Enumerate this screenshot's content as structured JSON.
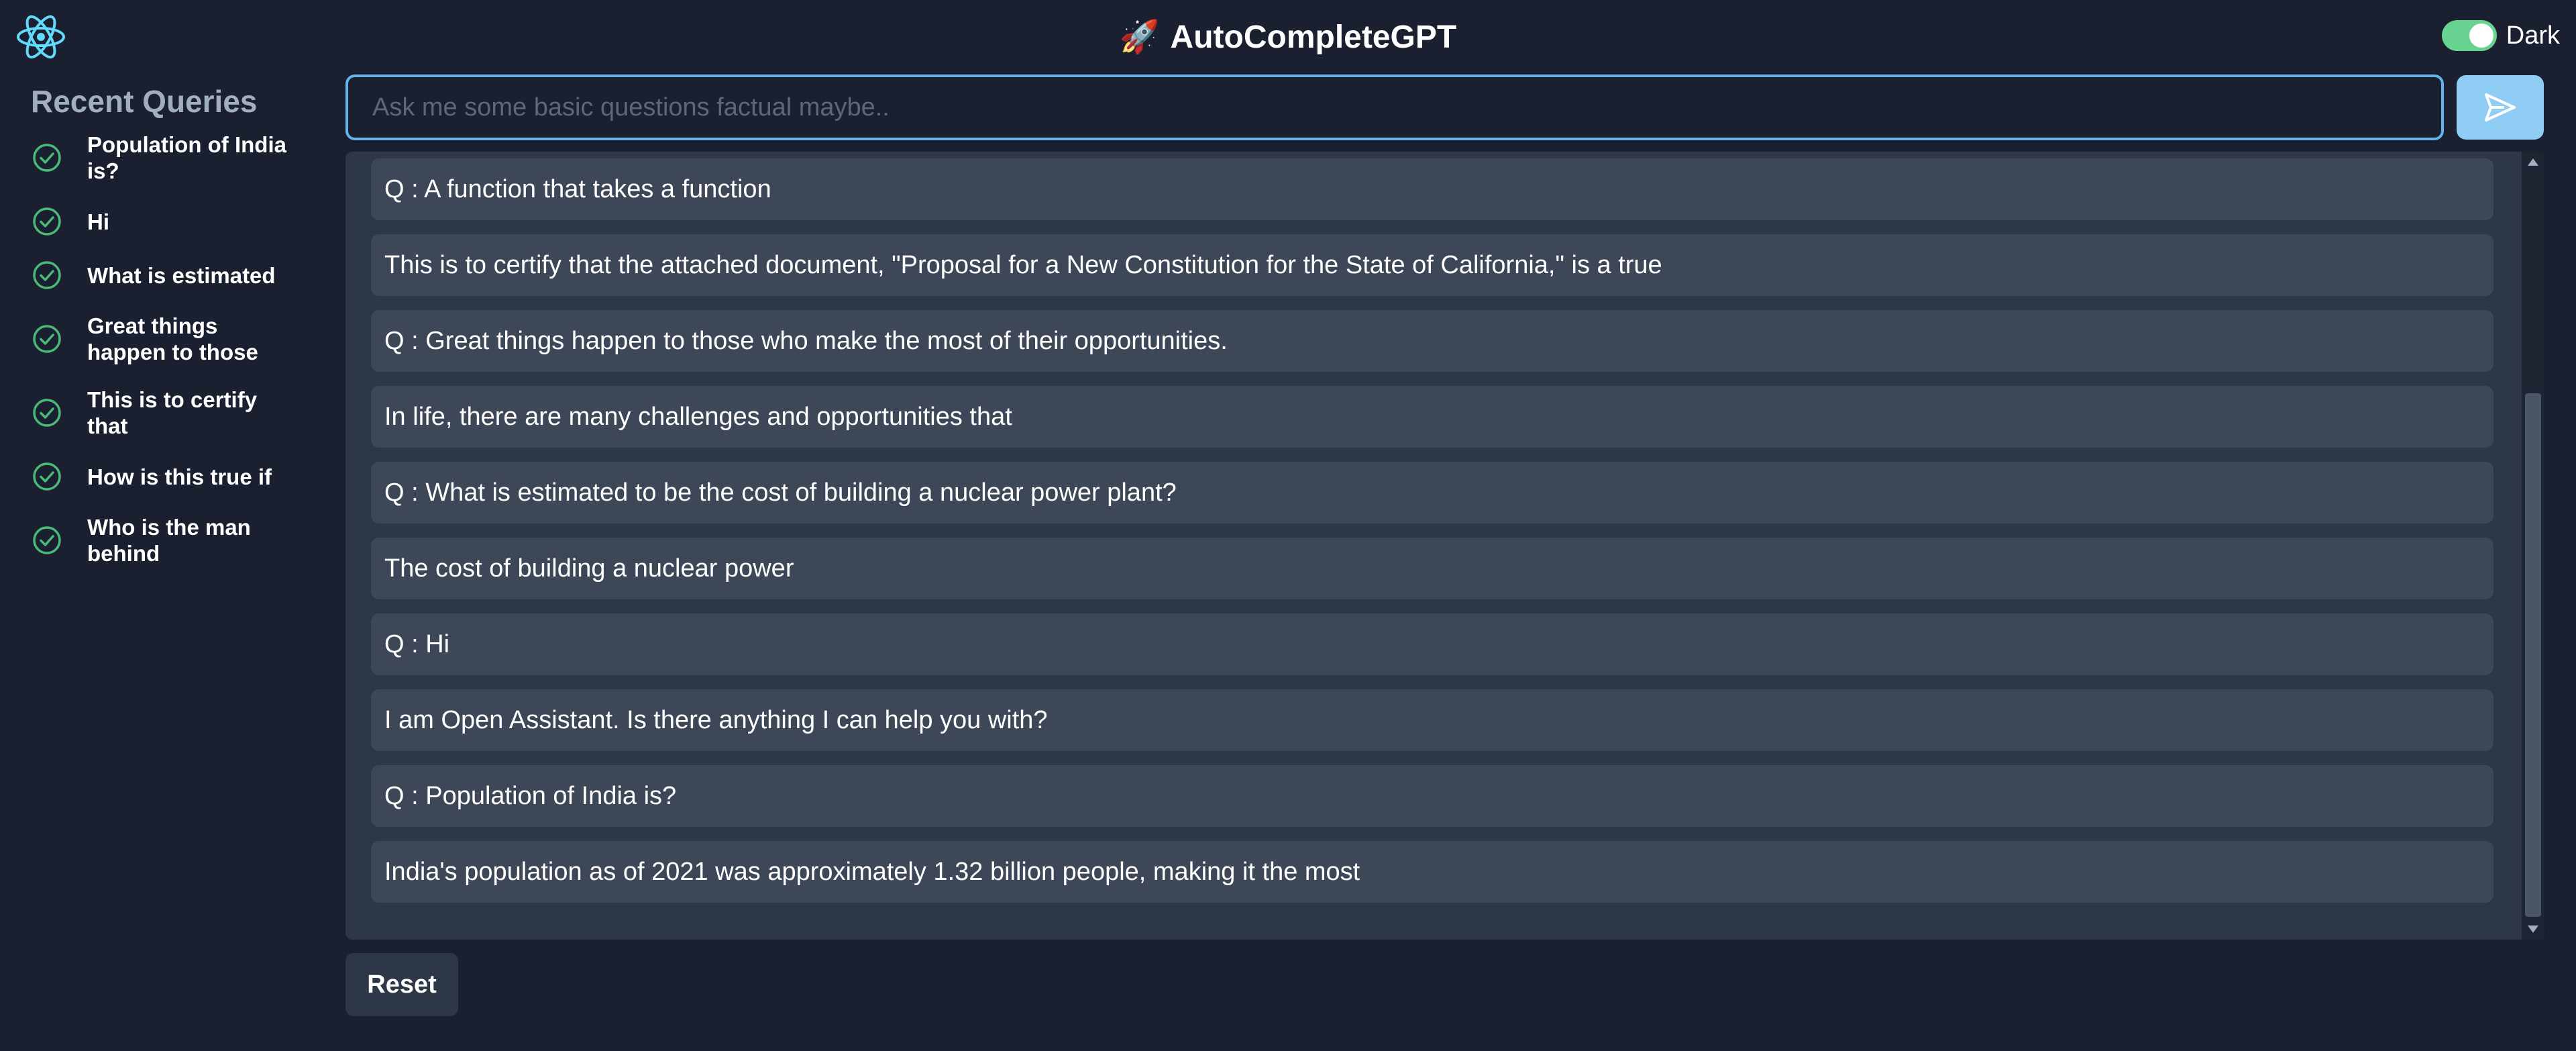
{
  "header": {
    "title": "AutoCompleteGPT",
    "title_emoji": "🚀",
    "logo_icon": "react-atom-icon",
    "theme_label": "Dark",
    "theme_toggle_on": true
  },
  "sidebar": {
    "title": "Recent Queries",
    "items": [
      {
        "label": "Population of India is?",
        "icon": "check-circle-icon"
      },
      {
        "label": "Hi",
        "icon": "check-circle-icon"
      },
      {
        "label": "What is estimated",
        "icon": "check-circle-icon"
      },
      {
        "label": "Great things happen to those",
        "icon": "check-circle-icon"
      },
      {
        "label": "This is to certify that",
        "icon": "check-circle-icon"
      },
      {
        "label": "How is this true if",
        "icon": "check-circle-icon"
      },
      {
        "label": "Who is the man behind",
        "icon": "check-circle-icon"
      }
    ]
  },
  "search": {
    "placeholder": "Ask me some basic questions factual maybe..",
    "value": "",
    "send_icon": "send-arrow-icon"
  },
  "messages": [
    {
      "text": "Q : A function that takes a function"
    },
    {
      "text": "This is to certify that the attached document, \"Proposal for a New Constitution for the State of California,\" is a true"
    },
    {
      "text": "Q : Great things happen to those who make the most of their opportunities."
    },
    {
      "text": "In life, there are many challenges and opportunities that"
    },
    {
      "text": "Q : What is estimated to be the cost of building a nuclear power plant?"
    },
    {
      "text": "The cost of building a nuclear power"
    },
    {
      "text": "Q : Hi"
    },
    {
      "text": "I am Open Assistant. Is there anything I can help you with?"
    },
    {
      "text": "Q : Population of India is?"
    },
    {
      "text": "India's population as of 2021 was approximately 1.32 billion people, making it the most"
    }
  ],
  "actions": {
    "reset_label": "Reset"
  },
  "colors": {
    "background": "#1b2030",
    "panel": "#2d3748",
    "message": "#3e4758",
    "accent": "#63b3ed",
    "send_button": "#90cdf4",
    "check": "#48bb78",
    "toggle": "#68d391",
    "logo": "#61dafb"
  }
}
